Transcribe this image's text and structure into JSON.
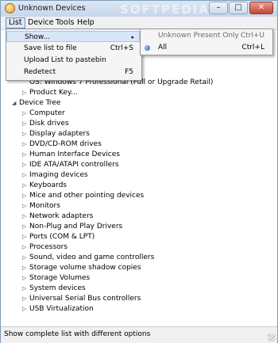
{
  "window": {
    "title": "Unknown Devices",
    "watermark": "SOFTPEDIA",
    "icon": "app-icon",
    "min_glyph": "–",
    "max_glyph": "□",
    "close_glyph": "✕"
  },
  "menubar": {
    "items": [
      "List",
      "Device",
      "Tools",
      "Help"
    ]
  },
  "list_menu": {
    "items": [
      {
        "label": "Show...",
        "shortcut": ""
      },
      {
        "label": "Save list to file",
        "shortcut": "Ctrl+S"
      },
      {
        "label": "Upload List to pastebin",
        "shortcut": ""
      },
      {
        "label": "Redetect",
        "shortcut": "F5"
      }
    ],
    "submenu_arrow": "▸"
  },
  "show_submenu": {
    "items": [
      {
        "label": "Unknown Present Only",
        "shortcut": "Ctrl+U"
      },
      {
        "label": "All",
        "shortcut": "Ctrl+L"
      }
    ]
  },
  "tree": {
    "os_line": "OS: Windows 7 Professional  (Full or Upgrade Retail)",
    "product_key": "Product Key...",
    "device_tree_label": "Device Tree",
    "expanded_glyph": "◢",
    "collapsed_glyph": "▷",
    "devices": [
      "Computer",
      "Disk drives",
      "Display adapters",
      "DVD/CD-ROM drives",
      "Human Interface Devices",
      "IDE ATA/ATAPI controllers",
      "Imaging devices",
      "Keyboards",
      "Mice and other pointing devices",
      "Monitors",
      "Network adapters",
      "Non-Plug and Play Drivers",
      "Ports (COM & LPT)",
      "Processors",
      "Sound, video and game controllers",
      "Storage volume shadow copies",
      "Storage Volumes",
      "System devices",
      "Universal Serial Bus controllers",
      "USB Virtualization"
    ]
  },
  "statusbar": {
    "text": "Show complete list with different options"
  }
}
